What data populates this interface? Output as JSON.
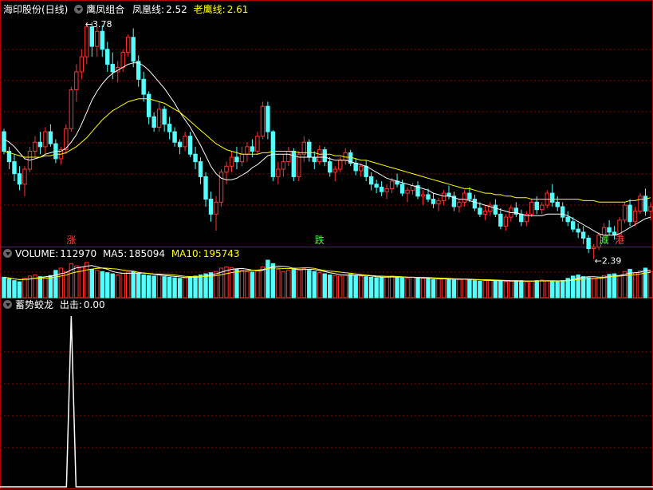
{
  "header": {
    "stock_name": "海印股份(日线)",
    "indicator_name": "鹰凤组合",
    "fh_label": "凤凰线:",
    "fh_value": "2.52",
    "lh_label": "老鹰线:",
    "lh_value": "2.61"
  },
  "volume_header": {
    "vol_label": "VOLUME:",
    "vol_value": "112970",
    "ma5_label": "MA5:",
    "ma5_value": "185094",
    "ma10_label": "MA10:",
    "ma10_value": "195743"
  },
  "signal_header": {
    "name": "蓄势蛟龙",
    "label": "出击:",
    "value": "0.00"
  },
  "annotations": {
    "high_label": "←3.78",
    "low_label": "←2.39"
  },
  "markers": [
    {
      "index": 13,
      "text": "涨",
      "color": "#ff4040"
    },
    {
      "index": 61,
      "text": "跌",
      "color": "#40ff40"
    },
    {
      "index": 116,
      "text": "减",
      "color": "#40ff40"
    },
    {
      "index": 119,
      "text": "港",
      "color": "#ff4040"
    }
  ],
  "colors": {
    "up": "#ff3232",
    "down": "#54ffff",
    "ma_short": "#ffffff",
    "ma_long": "#ffff00",
    "grid": "#8b0000",
    "frame": "#b40000",
    "signal": "#ffffff"
  },
  "chart_data": [
    {
      "type": "candlestick",
      "title": "鹰凤组合",
      "price_range": [
        2.39,
        3.78
      ],
      "series": [
        {
          "name": "凤凰线",
          "last": 2.52
        },
        {
          "name": "老鹰线",
          "last": 2.61
        }
      ],
      "ohlc": [
        [
          3.05,
          3.07,
          2.9,
          2.92
        ],
        [
          2.92,
          2.95,
          2.8,
          2.85
        ],
        [
          2.85,
          2.9,
          2.72,
          2.77
        ],
        [
          2.77,
          2.82,
          2.66,
          2.7
        ],
        [
          2.7,
          2.82,
          2.62,
          2.8
        ],
        [
          2.8,
          2.95,
          2.78,
          2.92
        ],
        [
          2.92,
          3.02,
          2.88,
          2.98
        ],
        [
          2.98,
          3.05,
          2.9,
          2.95
        ],
        [
          2.95,
          3.08,
          2.9,
          3.05
        ],
        [
          3.05,
          3.1,
          2.95,
          2.97
        ],
        [
          2.97,
          3.0,
          2.84,
          2.87
        ],
        [
          2.87,
          2.95,
          2.83,
          2.93
        ],
        [
          2.93,
          3.1,
          2.9,
          3.07
        ],
        [
          3.07,
          3.35,
          3.05,
          3.33
        ],
        [
          3.33,
          3.5,
          3.25,
          3.45
        ],
        [
          3.45,
          3.6,
          3.4,
          3.55
        ],
        [
          3.55,
          3.78,
          3.5,
          3.75
        ],
        [
          3.75,
          3.78,
          3.55,
          3.62
        ],
        [
          3.62,
          3.75,
          3.55,
          3.72
        ],
        [
          3.72,
          3.76,
          3.55,
          3.6
        ],
        [
          3.6,
          3.65,
          3.45,
          3.5
        ],
        [
          3.5,
          3.58,
          3.4,
          3.45
        ],
        [
          3.45,
          3.52,
          3.38,
          3.48
        ],
        [
          3.48,
          3.6,
          3.45,
          3.58
        ],
        [
          3.58,
          3.7,
          3.55,
          3.68
        ],
        [
          3.68,
          3.74,
          3.48,
          3.52
        ],
        [
          3.52,
          3.56,
          3.35,
          3.4
        ],
        [
          3.4,
          3.45,
          3.25,
          3.3
        ],
        [
          3.3,
          3.32,
          3.1,
          3.15
        ],
        [
          3.15,
          3.18,
          3.05,
          3.08
        ],
        [
          3.08,
          3.25,
          3.05,
          3.2
        ],
        [
          3.2,
          3.22,
          3.05,
          3.1
        ],
        [
          3.1,
          3.15,
          3.0,
          3.05
        ],
        [
          3.05,
          3.08,
          2.95,
          2.98
        ],
        [
          2.98,
          3.0,
          2.9,
          2.95
        ],
        [
          2.95,
          3.05,
          2.92,
          3.02
        ],
        [
          3.02,
          3.05,
          2.88,
          2.9
        ],
        [
          2.9,
          2.95,
          2.8,
          2.85
        ],
        [
          2.85,
          2.88,
          2.7,
          2.75
        ],
        [
          2.75,
          2.78,
          2.55,
          2.6
        ],
        [
          2.6,
          2.65,
          2.45,
          2.5
        ],
        [
          2.5,
          2.62,
          2.39,
          2.58
        ],
        [
          2.58,
          2.8,
          2.55,
          2.78
        ],
        [
          2.78,
          2.85,
          2.7,
          2.82
        ],
        [
          2.82,
          2.92,
          2.78,
          2.88
        ],
        [
          2.88,
          2.95,
          2.8,
          2.85
        ],
        [
          2.85,
          2.95,
          2.82,
          2.9
        ],
        [
          2.9,
          2.98,
          2.85,
          2.95
        ],
        [
          2.95,
          3.0,
          2.88,
          2.92
        ],
        [
          2.92,
          3.05,
          2.9,
          3.02
        ],
        [
          3.02,
          3.25,
          3.0,
          3.22
        ],
        [
          3.22,
          3.25,
          3.0,
          3.05
        ],
        [
          3.05,
          3.06,
          2.72,
          2.75
        ],
        [
          2.75,
          2.85,
          2.7,
          2.8
        ],
        [
          2.8,
          2.9,
          2.75,
          2.85
        ],
        [
          2.85,
          2.95,
          2.82,
          2.92
        ],
        [
          2.92,
          2.94,
          2.72,
          2.75
        ],
        [
          2.75,
          2.92,
          2.72,
          2.9
        ],
        [
          2.9,
          3.02,
          2.85,
          2.98
        ],
        [
          2.98,
          3.0,
          2.85,
          2.88
        ],
        [
          2.88,
          2.92,
          2.8,
          2.85
        ],
        [
          2.85,
          2.96,
          2.83,
          2.93
        ],
        [
          2.93,
          2.95,
          2.82,
          2.85
        ],
        [
          2.85,
          2.88,
          2.75,
          2.78
        ],
        [
          2.78,
          2.82,
          2.72,
          2.8
        ],
        [
          2.8,
          2.88,
          2.78,
          2.86
        ],
        [
          2.86,
          2.94,
          2.83,
          2.91
        ],
        [
          2.91,
          2.93,
          2.82,
          2.84
        ],
        [
          2.84,
          2.87,
          2.76,
          2.79
        ],
        [
          2.79,
          2.84,
          2.75,
          2.82
        ],
        [
          2.82,
          2.86,
          2.72,
          2.75
        ],
        [
          2.75,
          2.78,
          2.66,
          2.7
        ],
        [
          2.7,
          2.73,
          2.64,
          2.68
        ],
        [
          2.68,
          2.72,
          2.62,
          2.65
        ],
        [
          2.65,
          2.7,
          2.6,
          2.67
        ],
        [
          2.67,
          2.74,
          2.64,
          2.72
        ],
        [
          2.72,
          2.77,
          2.68,
          2.7
        ],
        [
          2.7,
          2.73,
          2.62,
          2.64
        ],
        [
          2.64,
          2.68,
          2.58,
          2.66
        ],
        [
          2.66,
          2.71,
          2.63,
          2.69
        ],
        [
          2.69,
          2.72,
          2.6,
          2.62
        ],
        [
          2.62,
          2.66,
          2.56,
          2.63
        ],
        [
          2.63,
          2.67,
          2.58,
          2.6
        ],
        [
          2.6,
          2.64,
          2.54,
          2.57
        ],
        [
          2.57,
          2.61,
          2.52,
          2.59
        ],
        [
          2.59,
          2.66,
          2.56,
          2.64
        ],
        [
          2.64,
          2.69,
          2.6,
          2.62
        ],
        [
          2.62,
          2.65,
          2.52,
          2.55
        ],
        [
          2.55,
          2.6,
          2.51,
          2.58
        ],
        [
          2.58,
          2.66,
          2.55,
          2.64
        ],
        [
          2.64,
          2.68,
          2.58,
          2.6
        ],
        [
          2.6,
          2.63,
          2.52,
          2.54
        ],
        [
          2.54,
          2.58,
          2.48,
          2.5
        ],
        [
          2.5,
          2.56,
          2.46,
          2.52
        ],
        [
          2.52,
          2.58,
          2.49,
          2.56
        ],
        [
          2.56,
          2.6,
          2.48,
          2.5
        ],
        [
          2.5,
          2.54,
          2.4,
          2.42
        ],
        [
          2.42,
          2.5,
          2.39,
          2.48
        ],
        [
          2.48,
          2.56,
          2.45,
          2.54
        ],
        [
          2.54,
          2.58,
          2.48,
          2.5
        ],
        [
          2.5,
          2.53,
          2.42,
          2.45
        ],
        [
          2.45,
          2.52,
          2.42,
          2.5
        ],
        [
          2.5,
          2.6,
          2.48,
          2.58
        ],
        [
          2.58,
          2.62,
          2.5,
          2.53
        ],
        [
          2.53,
          2.58,
          2.5,
          2.56
        ],
        [
          2.56,
          2.66,
          2.54,
          2.64
        ],
        [
          2.64,
          2.7,
          2.55,
          2.58
        ],
        [
          2.58,
          2.62,
          2.52,
          2.55
        ],
        [
          2.55,
          2.58,
          2.45,
          2.48
        ],
        [
          2.48,
          2.52,
          2.42,
          2.45
        ],
        [
          2.45,
          2.48,
          2.38,
          2.4
        ],
        [
          2.4,
          2.44,
          2.34,
          2.38
        ],
        [
          2.38,
          2.42,
          2.3,
          2.34
        ],
        [
          2.34,
          2.36,
          2.24,
          2.27
        ],
        [
          2.27,
          2.3,
          2.2,
          2.28
        ],
        [
          2.28,
          2.38,
          2.26,
          2.36
        ],
        [
          2.36,
          2.44,
          2.33,
          2.41
        ],
        [
          2.41,
          2.46,
          2.36,
          2.38
        ],
        [
          2.38,
          2.42,
          2.33,
          2.36
        ],
        [
          2.36,
          2.48,
          2.34,
          2.46
        ],
        [
          2.46,
          2.58,
          2.44,
          2.56
        ],
        [
          2.56,
          2.6,
          2.42,
          2.45
        ],
        [
          2.45,
          2.55,
          2.42,
          2.52
        ],
        [
          2.52,
          2.64,
          2.5,
          2.62
        ],
        [
          2.62,
          2.67,
          2.49,
          2.52
        ],
        [
          2.52,
          2.58,
          2.46,
          2.55
        ]
      ],
      "ma_short": [
        3.0,
        2.98,
        2.95,
        2.91,
        2.87,
        2.86,
        2.87,
        2.88,
        2.9,
        2.91,
        2.92,
        2.92,
        2.94,
        2.98,
        3.03,
        3.1,
        3.18,
        3.26,
        3.32,
        3.37,
        3.41,
        3.44,
        3.46,
        3.48,
        3.5,
        3.51,
        3.51,
        3.49,
        3.46,
        3.42,
        3.38,
        3.34,
        3.29,
        3.24,
        3.18,
        3.13,
        3.08,
        3.02,
        2.96,
        2.89,
        2.82,
        2.77,
        2.74,
        2.73,
        2.73,
        2.74,
        2.76,
        2.78,
        2.81,
        2.83,
        2.86,
        2.89,
        2.9,
        2.9,
        2.9,
        2.9,
        2.89,
        2.88,
        2.88,
        2.88,
        2.88,
        2.88,
        2.88,
        2.87,
        2.86,
        2.86,
        2.86,
        2.85,
        2.84,
        2.83,
        2.82,
        2.8,
        2.78,
        2.76,
        2.74,
        2.73,
        2.72,
        2.71,
        2.7,
        2.69,
        2.68,
        2.67,
        2.66,
        2.64,
        2.63,
        2.62,
        2.62,
        2.61,
        2.6,
        2.6,
        2.59,
        2.58,
        2.57,
        2.56,
        2.55,
        2.54,
        2.53,
        2.52,
        2.51,
        2.51,
        2.5,
        2.49,
        2.49,
        2.49,
        2.49,
        2.5,
        2.5,
        2.5,
        2.5,
        2.49,
        2.47,
        2.45,
        2.43,
        2.41,
        2.39,
        2.37,
        2.36,
        2.36,
        2.36,
        2.37,
        2.39,
        2.41,
        2.43,
        2.45,
        2.47,
        2.48
      ],
      "ma_long": [
        2.92,
        2.91,
        2.9,
        2.89,
        2.88,
        2.88,
        2.88,
        2.88,
        2.89,
        2.89,
        2.9,
        2.9,
        2.91,
        2.93,
        2.95,
        2.98,
        3.01,
        3.05,
        3.09,
        3.13,
        3.16,
        3.19,
        3.21,
        3.23,
        3.25,
        3.26,
        3.27,
        3.27,
        3.27,
        3.26,
        3.25,
        3.24,
        3.22,
        3.2,
        3.18,
        3.15,
        3.12,
        3.09,
        3.06,
        3.03,
        3.0,
        2.97,
        2.95,
        2.93,
        2.92,
        2.91,
        2.9,
        2.9,
        2.9,
        2.9,
        2.91,
        2.91,
        2.92,
        2.92,
        2.92,
        2.92,
        2.92,
        2.91,
        2.91,
        2.91,
        2.91,
        2.9,
        2.9,
        2.9,
        2.89,
        2.89,
        2.88,
        2.88,
        2.87,
        2.86,
        2.86,
        2.85,
        2.84,
        2.83,
        2.82,
        2.81,
        2.8,
        2.79,
        2.78,
        2.77,
        2.76,
        2.75,
        2.74,
        2.73,
        2.72,
        2.71,
        2.7,
        2.69,
        2.68,
        2.67,
        2.67,
        2.66,
        2.65,
        2.64,
        2.64,
        2.63,
        2.63,
        2.62,
        2.62,
        2.61,
        2.61,
        2.61,
        2.6,
        2.6,
        2.6,
        2.6,
        2.6,
        2.6,
        2.6,
        2.6,
        2.6,
        2.6,
        2.59,
        2.59,
        2.59,
        2.58,
        2.58,
        2.58,
        2.58,
        2.58,
        2.58,
        2.59,
        2.59,
        2.6,
        2.6,
        2.61
      ]
    },
    {
      "type": "bar",
      "title": "VOLUME",
      "values": [
        180,
        165,
        150,
        140,
        170,
        190,
        200,
        185,
        175,
        195,
        240,
        260,
        230,
        300,
        280,
        270,
        310,
        250,
        240,
        230,
        220,
        210,
        200,
        215,
        225,
        230,
        210,
        200,
        195,
        190,
        205,
        185,
        180,
        175,
        170,
        175,
        185,
        190,
        200,
        210,
        220,
        230,
        260,
        270,
        265,
        250,
        240,
        230,
        225,
        240,
        270,
        330,
        300,
        250,
        230,
        240,
        260,
        250,
        255,
        240,
        230,
        220,
        210,
        200,
        195,
        190,
        200,
        205,
        195,
        190,
        185,
        180,
        175,
        180,
        185,
        190,
        180,
        175,
        170,
        180,
        175,
        170,
        165,
        160,
        165,
        170,
        160,
        155,
        160,
        165,
        160,
        150,
        145,
        150,
        155,
        150,
        145,
        140,
        145,
        150,
        150,
        140,
        145,
        150,
        155,
        150,
        145,
        140,
        150,
        170,
        190,
        200,
        185,
        175,
        170,
        180,
        195,
        205,
        210,
        190,
        230,
        250,
        220,
        235,
        260,
        230
      ]
    },
    {
      "type": "line",
      "title": "蓄势蛟龙",
      "series": [
        {
          "name": "出击",
          "spike_index": 13,
          "spike_value": 1,
          "other_value": 0
        }
      ]
    }
  ]
}
